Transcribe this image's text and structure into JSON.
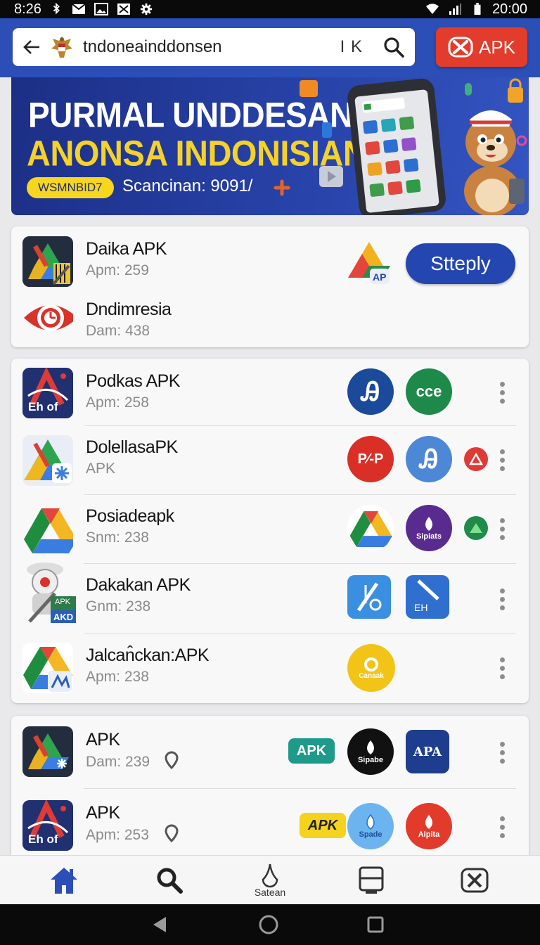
{
  "status_bar": {
    "time": "8:26",
    "clock": "20:00"
  },
  "header": {
    "search_text": "tndoneainddonsen",
    "search_suffix": "I K",
    "apk_button_label": "APK",
    "accent_color": "#2b4fb6",
    "apk_button_color": "#e23c2c"
  },
  "banner": {
    "title_line1": "PURMAL UNDDESAN",
    "title_line2": "ANONSA INDONISIAN",
    "badge": "WSMNBID7",
    "subtitle": "Scancinan: 9091/"
  },
  "card1": {
    "action_label": "Stteply",
    "items": [
      {
        "name": "Daika APK",
        "meta": "Apm: 259",
        "icon": "google-drive-pencil-icon"
      },
      {
        "name": "Dndimresia",
        "meta": "Dam: 438",
        "icon": "red-eye-icon"
      }
    ],
    "side_icon_label": "AP"
  },
  "card2": {
    "items": [
      {
        "name": "Podkas APK",
        "meta": "Apm: 258",
        "side_icons": [
          "Ꭿ",
          "cce"
        ]
      },
      {
        "name": "DolellasaPK",
        "meta": "APK",
        "side_icons": [
          "P⁄-P",
          "Ꭿ"
        ]
      },
      {
        "name": "Posiadeapk",
        "meta": "Snm: 238",
        "side_icons": [
          "",
          "Sipiats"
        ]
      },
      {
        "name": "Dakakan APK",
        "meta": "Gnm: 238",
        "side_icons": [
          "",
          "EH"
        ]
      },
      {
        "name": "Jalcan̂ckan:APK",
        "meta": "Apm: 238",
        "side_icons": [
          "Canaak"
        ]
      }
    ],
    "icon_badge_labels": [
      "Eh of",
      "APK",
      "AKD",
      "Eh of"
    ]
  },
  "card3": {
    "items": [
      {
        "name": "APK",
        "meta": "Dam: 239",
        "tag": "APK",
        "side_icons": [
          "Sipabe",
          "APA"
        ]
      },
      {
        "name": "APK",
        "meta": "Apm: 253",
        "tag": "APK",
        "side_icons": [
          "Spade",
          "Alpita"
        ]
      }
    ]
  },
  "bottom_nav": {
    "items": [
      {
        "icon": "home-icon",
        "label": ""
      },
      {
        "icon": "search-icon",
        "label": ""
      },
      {
        "icon": "drop-icon",
        "label": "Satean"
      },
      {
        "icon": "downloads-icon",
        "label": ""
      },
      {
        "icon": "apk-x-icon",
        "label": ""
      }
    ]
  }
}
